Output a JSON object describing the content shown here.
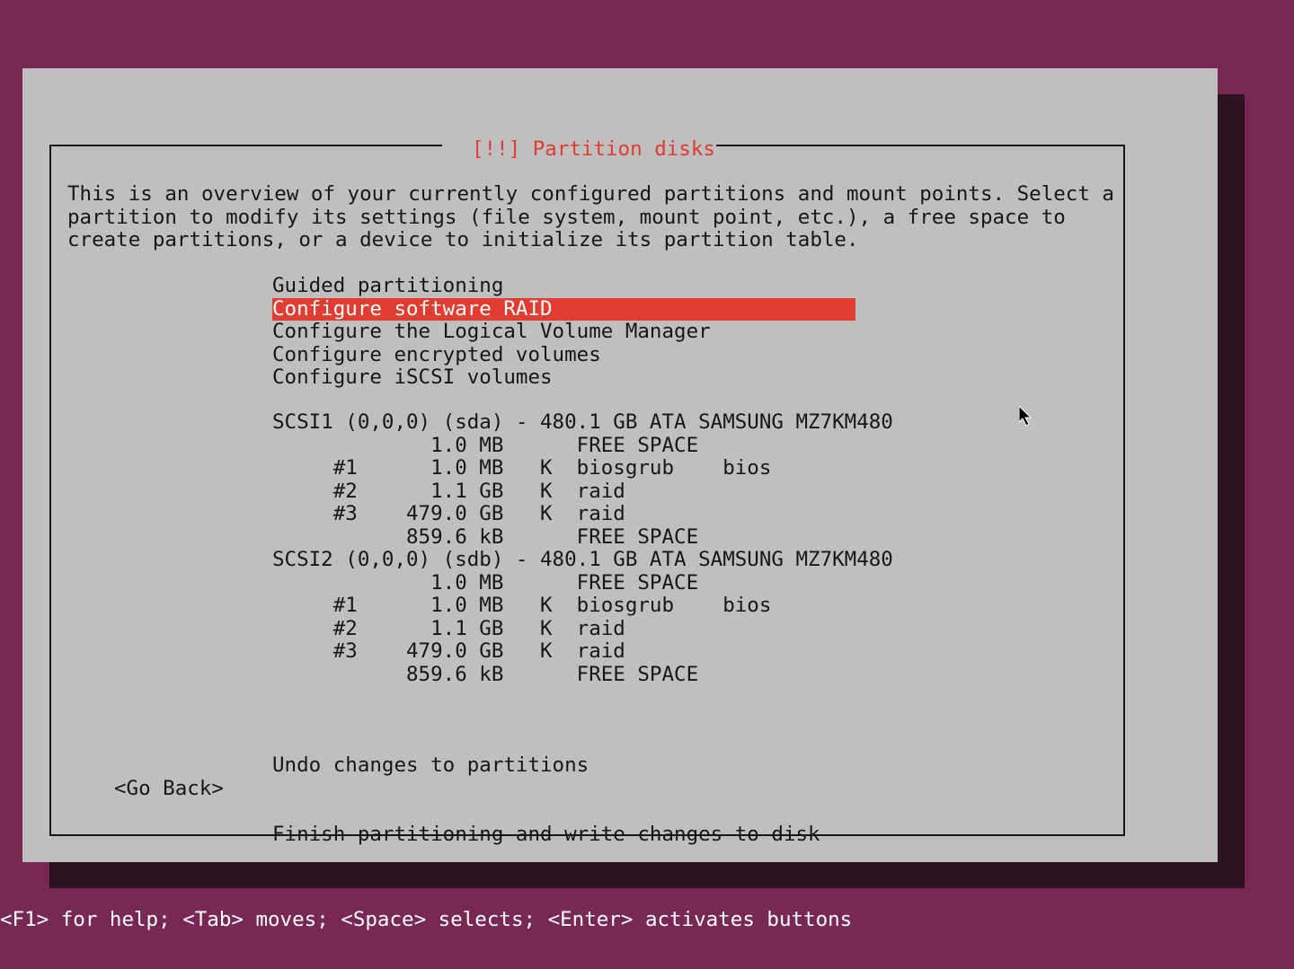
{
  "title": "[!!] Partition disks",
  "instructions": "This is an overview of your currently configured partitions and mount points. Select a partition to modify its settings (file system, mount point, etc.), a free space to create partitions, or a device to initialize its partition table.",
  "menu": {
    "items": [
      {
        "label": "Guided partitioning",
        "selected": false
      },
      {
        "label": "Configure software RAID",
        "selected": true
      },
      {
        "label": "Configure the Logical Volume Manager",
        "selected": false
      },
      {
        "label": "Configure encrypted volumes",
        "selected": false
      },
      {
        "label": "Configure iSCSI volumes",
        "selected": false
      }
    ]
  },
  "disks": [
    {
      "header": "SCSI1 (0,0,0) (sda) - 480.1 GB ATA SAMSUNG MZ7KM480",
      "rows": [
        {
          "num": "",
          "size": "1.0 MB",
          "flag": "",
          "fs": "FREE SPACE",
          "use": ""
        },
        {
          "num": "#1",
          "size": "1.0 MB",
          "flag": "K",
          "fs": "biosgrub",
          "use": "bios"
        },
        {
          "num": "#2",
          "size": "1.1 GB",
          "flag": "K",
          "fs": "raid",
          "use": ""
        },
        {
          "num": "#3",
          "size": "479.0 GB",
          "flag": "K",
          "fs": "raid",
          "use": ""
        },
        {
          "num": "",
          "size": "859.6 kB",
          "flag": "",
          "fs": "FREE SPACE",
          "use": ""
        }
      ]
    },
    {
      "header": "SCSI2 (0,0,0) (sdb) - 480.1 GB ATA SAMSUNG MZ7KM480",
      "rows": [
        {
          "num": "",
          "size": "1.0 MB",
          "flag": "",
          "fs": "FREE SPACE",
          "use": ""
        },
        {
          "num": "#1",
          "size": "1.0 MB",
          "flag": "K",
          "fs": "biosgrub",
          "use": "bios"
        },
        {
          "num": "#2",
          "size": "1.1 GB",
          "flag": "K",
          "fs": "raid",
          "use": ""
        },
        {
          "num": "#3",
          "size": "479.0 GB",
          "flag": "K",
          "fs": "raid",
          "use": ""
        },
        {
          "num": "",
          "size": "859.6 kB",
          "flag": "",
          "fs": "FREE SPACE",
          "use": ""
        }
      ]
    }
  ],
  "bottom": {
    "undo": "Undo changes to partitions",
    "finish": "Finish partitioning and write changes to disk"
  },
  "go_back": "<Go Back>",
  "footer": "<F1> for help; <Tab> moves; <Space> selects; <Enter> activates buttons"
}
